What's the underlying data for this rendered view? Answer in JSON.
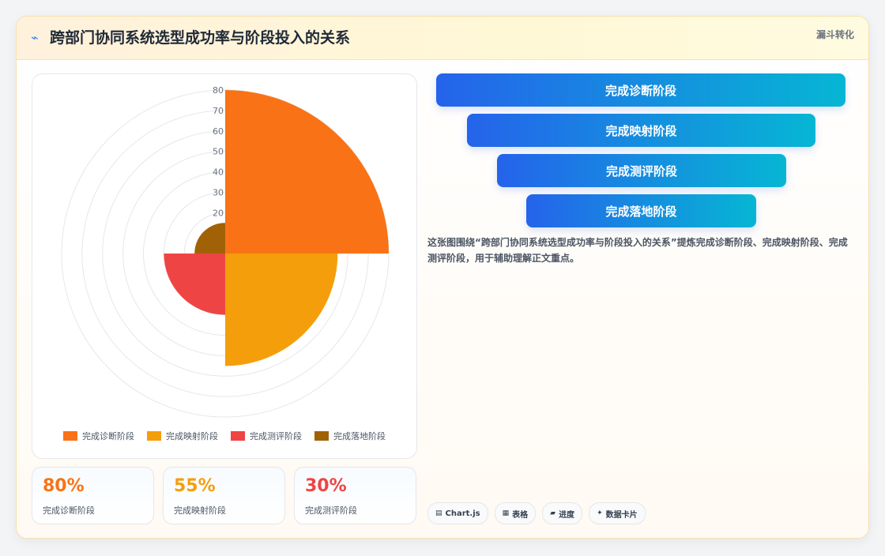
{
  "header": {
    "title": "跨部门协同系统选型成功率与阶段投入的关系",
    "badge": "漏斗转化",
    "icon": "sparkle-icon"
  },
  "chart_data": {
    "type": "polarArea",
    "categories": [
      "完成诊断阶段",
      "完成映射阶段",
      "完成测评阶段",
      "完成落地阶段"
    ],
    "values": [
      80,
      55,
      30,
      15
    ],
    "colors": [
      "#f97316",
      "#f59e0b",
      "#ef4444",
      "#a16207"
    ],
    "rmax": 80,
    "ticks": [
      "20",
      "30",
      "40",
      "50",
      "60",
      "70",
      "80"
    ],
    "legend_position": "bottom"
  },
  "kpis": [
    {
      "value": "80%",
      "label": "完成诊断阶段",
      "color": "#f97316"
    },
    {
      "value": "55%",
      "label": "完成映射阶段",
      "color": "#f59e0b"
    },
    {
      "value": "30%",
      "label": "完成测评阶段",
      "color": "#ef4444"
    }
  ],
  "funnel": [
    "完成诊断阶段",
    "完成映射阶段",
    "完成测评阶段",
    "完成落地阶段"
  ],
  "description": "这张图围绕“跨部门协同系统选型成功率与阶段投入的关系”提炼完成诊断阶段、完成映射阶段、完成测评阶段，用于辅助理解正文重点。",
  "tags": [
    {
      "icon": "▤",
      "label": "Chart.js"
    },
    {
      "icon": "▦",
      "label": "表格"
    },
    {
      "icon": "▰",
      "label": "进度"
    },
    {
      "icon": "✦",
      "label": "数据卡片"
    }
  ]
}
